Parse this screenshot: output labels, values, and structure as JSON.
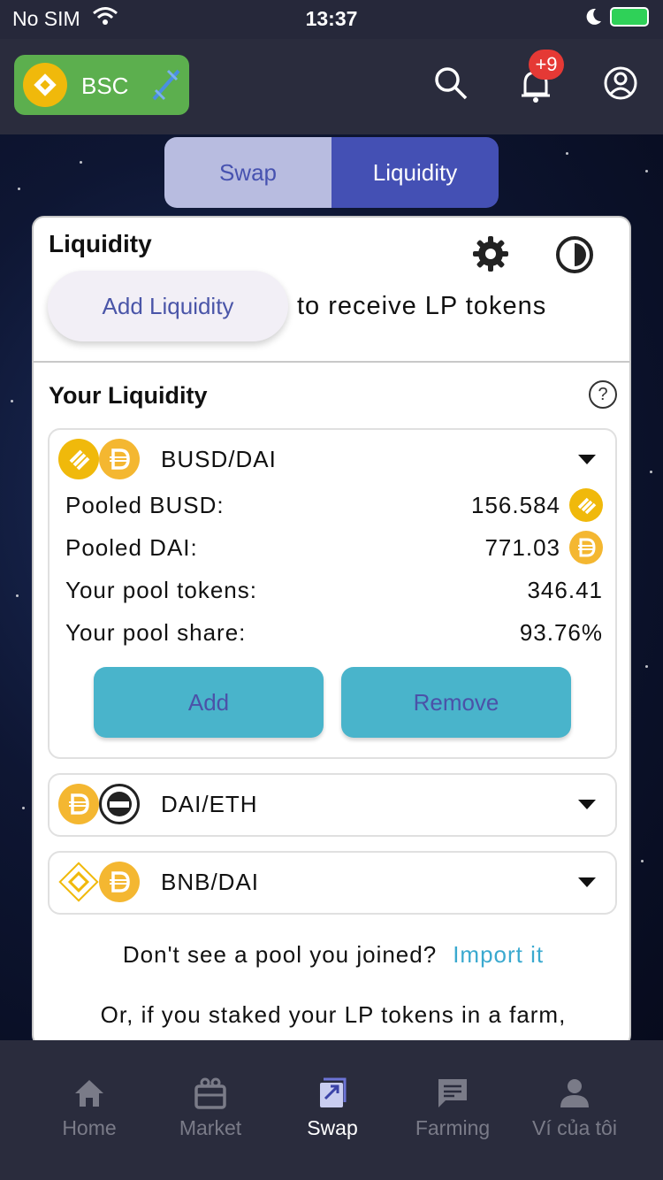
{
  "status_bar": {
    "carrier": "No SIM",
    "time": "13:37"
  },
  "header": {
    "network": "BSC",
    "notification_count": "+9"
  },
  "segment": {
    "swap_label": "Swap",
    "liquidity_label": "Liquidity"
  },
  "card": {
    "title": "Liquidity",
    "add_liquidity_label": "Add Liquidity",
    "receive_text": "to receive LP tokens",
    "your_liquidity_title": "Your Liquidity",
    "help_glyph": "?"
  },
  "pools": [
    {
      "name": "BUSD/DAI",
      "pooled_a_label": "Pooled BUSD:",
      "pooled_a_value": "156.584",
      "pooled_b_label": "Pooled DAI:",
      "pooled_b_value": "771.03",
      "tokens_label": "Your pool tokens:",
      "tokens_value": "346.41",
      "share_label": "Your pool share:",
      "share_value": "93.76%",
      "add_label": "Add",
      "remove_label": "Remove"
    },
    {
      "name": "DAI/ETH"
    },
    {
      "name": "BNB/DAI"
    }
  ],
  "footer": {
    "missing_pool_text": "Don't see a pool you joined?",
    "import_link": "Import it",
    "staked_text": "Or, if you staked your LP tokens in a farm,"
  },
  "tabbar": {
    "items": [
      {
        "label": "Home",
        "icon": "home-icon"
      },
      {
        "label": "Market",
        "icon": "market-icon"
      },
      {
        "label": "Swap",
        "icon": "swap-icon"
      },
      {
        "label": "Farming",
        "icon": "farming-icon"
      },
      {
        "label": "Ví của tôi",
        "icon": "wallet-user-icon"
      }
    ],
    "active": "Swap"
  },
  "colors": {
    "accent": "#4450b4",
    "button": "#49b4cb",
    "bsc_green": "#5caf4e",
    "link": "#3aa9cf",
    "busd": "#f0b90b",
    "dai": "#f4b731"
  }
}
